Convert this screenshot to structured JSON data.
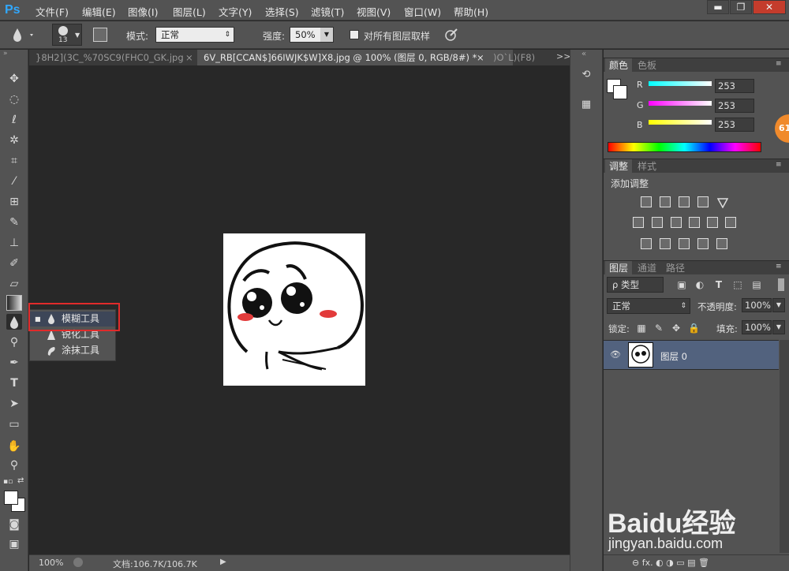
{
  "app": {
    "logo": "Ps"
  },
  "menubar": {
    "items": [
      "文件(F)",
      "编辑(E)",
      "图像(I)",
      "图层(L)",
      "文字(Y)",
      "选择(S)",
      "滤镜(T)",
      "视图(V)",
      "窗口(W)",
      "帮助(H)"
    ],
    "win_minimize": "▬",
    "win_restore": "❐",
    "win_close": "✕"
  },
  "options": {
    "brush_size": "13",
    "mode_label": "模式:",
    "mode_value": "正常",
    "strength_label": "强度:",
    "strength_value": "50%",
    "sample_all_label": "对所有图层取样"
  },
  "tabs": [
    {
      "label": "}8H2](3C_%70SC9(FHC0_GK.jpg",
      "close": "×"
    },
    {
      "label": "6V_RB[CCAN$]66IWJK$W]X8.jpg @ 100% (图层 0, RGB/8#) *",
      "close": "×"
    },
    {
      "label": ")O`L)(F8)",
      "close": ""
    }
  ],
  "tab_overflow": ">>",
  "flyout": {
    "items": [
      {
        "label": "模糊工具",
        "icon": "blur-drop-icon",
        "selected": true
      },
      {
        "label": "锐化工具",
        "icon": "sharpen-cone-icon",
        "selected": false
      },
      {
        "label": "涂抹工具",
        "icon": "smudge-finger-icon",
        "selected": false
      }
    ]
  },
  "status": {
    "zoom": "100%",
    "doc": "文档:106.7K/106.7K",
    "arrow": "▶"
  },
  "color_panel": {
    "tabs": [
      "颜色",
      "色板"
    ],
    "channels": [
      {
        "name": "R",
        "value": "253"
      },
      {
        "name": "G",
        "value": "253"
      },
      {
        "name": "B",
        "value": "253"
      }
    ],
    "badge": "61"
  },
  "adjust_panel": {
    "tabs": [
      "调整",
      "样式"
    ],
    "title": "添加调整"
  },
  "layers_panel": {
    "tabs": [
      "图层",
      "通道",
      "路径"
    ],
    "filter_label": "ρ 类型",
    "blend": "正常",
    "opacity_label": "不透明度:",
    "opacity_value": "100%",
    "lock_label": "锁定:",
    "fill_label": "填充:",
    "fill_value": "100%",
    "layer": {
      "name": "图层 0",
      "visible": "👁"
    },
    "bottom_icons": "⊖  fx.  ◐  ◑  ▭  ▤  🗑"
  },
  "watermark": {
    "brand": "Baidu经验",
    "url": "jingyan.baidu.com"
  },
  "colors": {
    "accent_red": "#e12b2b",
    "ps_blue": "#31a8ff",
    "blush": "#e23b3b"
  }
}
